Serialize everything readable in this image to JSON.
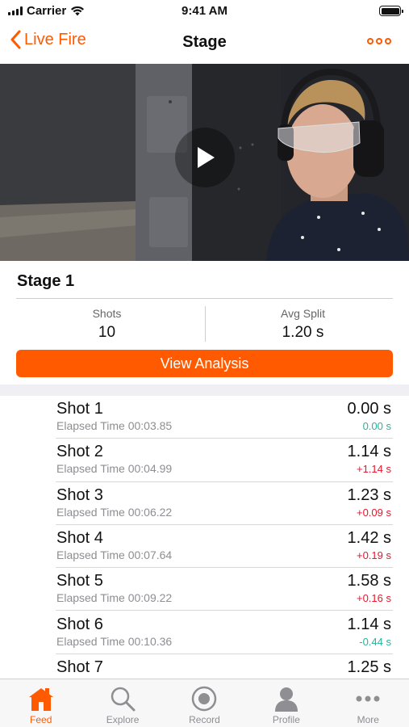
{
  "status_bar": {
    "carrier": "Carrier",
    "time": "9:41 AM"
  },
  "nav": {
    "back_label": "Live Fire",
    "title": "Stage"
  },
  "stage": {
    "name": "Stage 1",
    "shots_label": "Shots",
    "shots_value": "10",
    "avg_split_label": "Avg Split",
    "avg_split_value": "1.20 s",
    "analysis_button": "View Analysis"
  },
  "shots": [
    {
      "name": "Shot 1",
      "elapsed": "Elapsed Time 00:03.85",
      "time": "0.00 s",
      "split": "0.00 s",
      "split_color": "#2bb39a"
    },
    {
      "name": "Shot 2",
      "elapsed": "Elapsed Time 00:04.99",
      "time": "1.14 s",
      "split": "+1.14 s",
      "split_color": "#e6162d"
    },
    {
      "name": "Shot 3",
      "elapsed": "Elapsed Time 00:06.22",
      "time": "1.23 s",
      "split": "+0.09 s",
      "split_color": "#e6162d"
    },
    {
      "name": "Shot 4",
      "elapsed": "Elapsed Time 00:07.64",
      "time": "1.42 s",
      "split": "+0.19 s",
      "split_color": "#e6162d"
    },
    {
      "name": "Shot 5",
      "elapsed": "Elapsed Time 00:09.22",
      "time": "1.58 s",
      "split": "+0.16 s",
      "split_color": "#e6162d"
    },
    {
      "name": "Shot 6",
      "elapsed": "Elapsed Time 00:10.36",
      "time": "1.14 s",
      "split": "-0.44 s",
      "split_color": "#2bb39a"
    },
    {
      "name": "Shot 7",
      "elapsed": "",
      "time": "1.25 s",
      "split": "",
      "split_color": "#e6162d"
    }
  ],
  "tabs": [
    {
      "label": "Feed",
      "icon": "house-icon",
      "active": true
    },
    {
      "label": "Explore",
      "icon": "search-icon",
      "active": false
    },
    {
      "label": "Record",
      "icon": "record-icon",
      "active": false
    },
    {
      "label": "Profile",
      "icon": "profile-icon",
      "active": false
    },
    {
      "label": "More",
      "icon": "more-dots-icon",
      "active": false
    }
  ],
  "colors": {
    "accent": "#ff5a00",
    "positive": "#2bb39a",
    "negative": "#e6162d",
    "inactive": "#8e8e93"
  }
}
